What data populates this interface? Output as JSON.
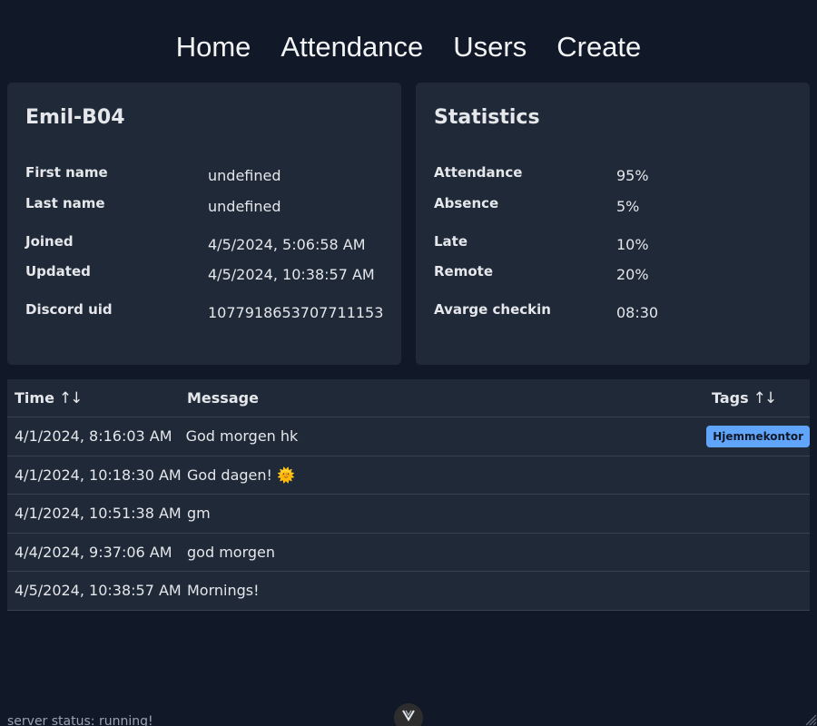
{
  "nav": {
    "items": [
      {
        "label": "Home"
      },
      {
        "label": "Attendance"
      },
      {
        "label": "Users"
      },
      {
        "label": "Create"
      }
    ]
  },
  "user": {
    "title": "Emil-B04",
    "first_name_label": "First name",
    "first_name": "undefined",
    "last_name_label": "Last name",
    "last_name": "undefined",
    "joined_label": "Joined",
    "joined": "4/5/2024, 5:06:58 AM",
    "updated_label": "Updated",
    "updated": "4/5/2024, 10:38:57 AM",
    "discord_label": "Discord uid",
    "discord": "1077918653707711153"
  },
  "stats": {
    "title": "Statistics",
    "attendance_label": "Attendance",
    "attendance": "95%",
    "absence_label": "Absence",
    "absence": "5%",
    "late_label": "Late",
    "late": "10%",
    "remote_label": "Remote",
    "remote": "20%",
    "checkin_label": "Avarge checkin",
    "checkin": "08:30"
  },
  "table": {
    "headers": {
      "time": "Time",
      "message": "Message",
      "tags": "Tags"
    },
    "sort_glyph": "↑↓",
    "rows": [
      {
        "time": "4/1/2024, 8:16:03 AM",
        "message": "God morgen hk",
        "tag": "Hjemmekontor"
      },
      {
        "time": "4/1/2024, 10:18:30 AM",
        "message": "God dagen! 🌞",
        "tag": ""
      },
      {
        "time": "4/1/2024, 10:51:38 AM",
        "message": "gm",
        "tag": ""
      },
      {
        "time": "4/4/2024, 9:37:06 AM",
        "message": "god morgen",
        "tag": ""
      },
      {
        "time": "4/5/2024, 10:38:57 AM",
        "message": "Mornings!",
        "tag": ""
      }
    ]
  },
  "footer": {
    "status": "server status: running!"
  },
  "colors": {
    "background": "#111827",
    "card": "#1f2937",
    "tag": "#60a5fa"
  }
}
